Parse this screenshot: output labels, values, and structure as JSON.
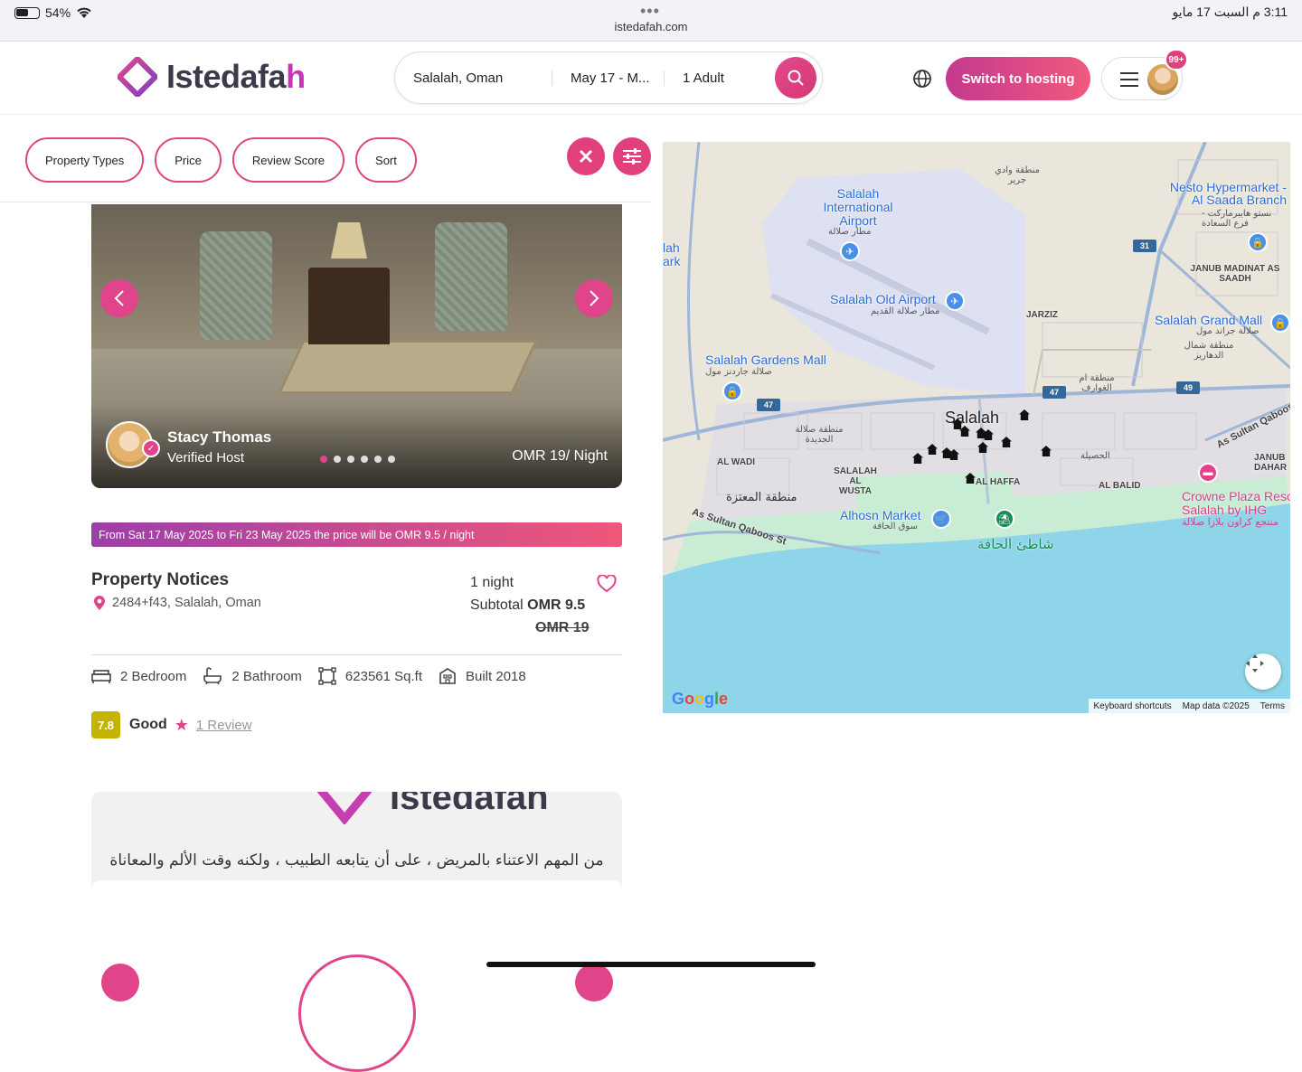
{
  "status_bar": {
    "battery": "54%",
    "url": "istedafah.com",
    "time": "3:11 م  السبت 17 مايو"
  },
  "header": {
    "logo_text_main": "Istedafa",
    "logo_text_end": "h",
    "search": {
      "location": "Salalah, Oman",
      "dates": "May 17 - M...",
      "guests": "1 Adult"
    },
    "switch_hosting": "Switch to hosting",
    "notification_badge": "99+"
  },
  "filters": {
    "items": [
      "Property Types",
      "Price",
      "Review Score",
      "Sort"
    ]
  },
  "listing": {
    "host_name": "Stacy Thomas",
    "host_label": "Verified Host",
    "price_per_night": "OMR 19/ Night",
    "carousel_dots": 6,
    "active_dot": 0,
    "promo": "From Sat 17 May 2025 to Fri 23 May 2025 the price will be OMR 9.5 / night",
    "title": "Property Notices",
    "address": "2484+f43, Salalah, Oman",
    "nights": "1 night",
    "subtotal_label": "Subtotal",
    "subtotal_value": "OMR 9.5",
    "old_price": "OMR 19",
    "amenities": {
      "bedroom": "2 Bedroom",
      "bathroom": "2 Bathroom",
      "area": "623561 Sq.ft",
      "built": "Built 2018"
    },
    "score": "7.8",
    "score_label": "Good",
    "reviews": "1 Review"
  },
  "card2": {
    "logo_text": "Istedafah",
    "arabic_text": "من المهم الاعتناء بالمريض ، على أن يتابعه الطبيب ، ولكنه وقت الألم والمعاناة"
  },
  "map": {
    "labels": {
      "airport": "Salalah International Airport",
      "airport_ar": "مطار صلالة",
      "old_airport": "Salalah Old Airport",
      "old_airport_ar": "مطار صلالة القديم",
      "gardens_mall": "Salalah Gardens Mall",
      "gardens_mall_ar": "صلالة جاردنز مول",
      "nesto": "Nesto Hypermarket - Al Saada Branch",
      "nesto_ar": "نستو هايبرماركت - فرع السعادة",
      "grand_mall": "Salalah Grand Mall",
      "grand_mall_ar": "صلالة جراند مول",
      "city": "Salalah",
      "alhosn": "Alhosn Market",
      "alhosn_ar": "سوق الحافة",
      "crowne": "Crowne Plaza Reso",
      "crowne2": "Salalah by IHG",
      "crowne_ar": "منتجع كراون بلازا صلالة",
      "beach_ar": "شاطئ الحافة",
      "jarziz": "JARZIZ",
      "janub_madinat": "JANUB MADINAT AS SAADH",
      "al_wadi": "AL WADI",
      "salalah_wusta": "SALALAH AL WUSTA",
      "al_haffa": "AL HAFFA",
      "al_balid": "AL BALID",
      "janub_dahar": "JANUB DAHAR",
      "road": "As Sultan Qaboos St",
      "road2": "As Sultan Qaboos",
      "mutaza_ar": "منطقة المعتزة",
      "jadida_ar": "منطقة صلالة الجديدة",
      "dahariz_ar": "منطقة شمال الدهاريز",
      "awaf_ar": "منطقة ام الغوارف",
      "husail_ar": "الحصيلة",
      "wadi_jarir_ar": "منطقة وادي جرير",
      "edge_label": "lah ark",
      "r31": "31",
      "r47a": "47",
      "r47b": "47",
      "r49": "49"
    },
    "footer": {
      "google": "Google",
      "shortcuts": "Keyboard shortcuts",
      "data": "Map data ©2025",
      "terms": "Terms"
    },
    "colors": {
      "sea": "#8fd5ea",
      "park": "#c9ecd4",
      "land": "#ebe6dc",
      "airport": "#dde1f2"
    }
  }
}
